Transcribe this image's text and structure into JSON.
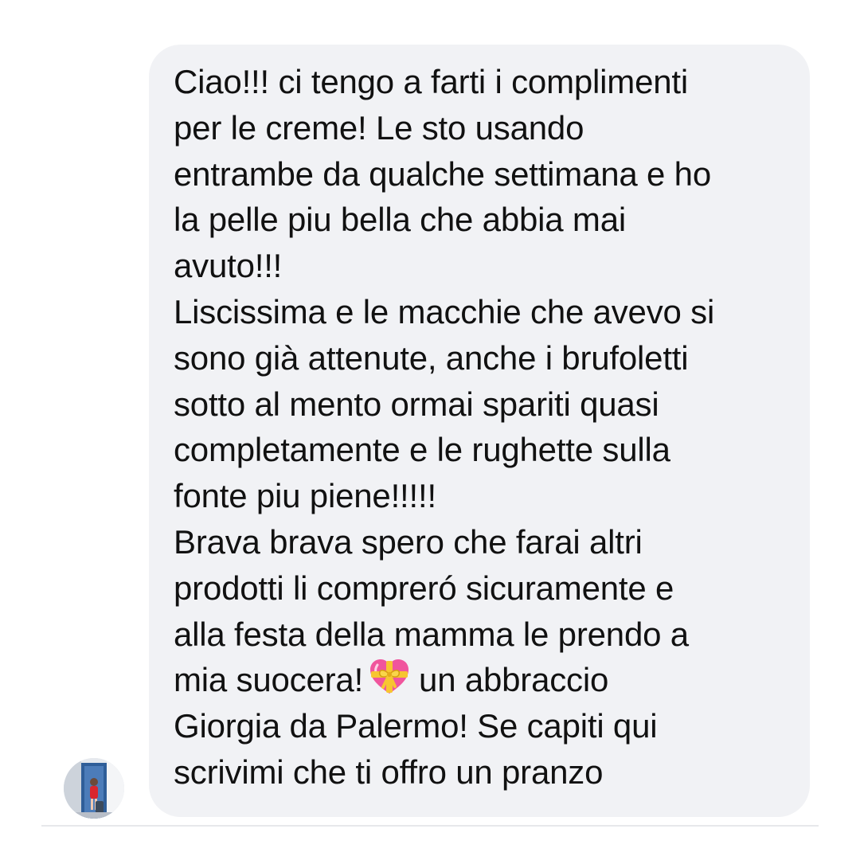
{
  "message": {
    "lines": [
      "Ciao!!! ci tengo a farti i complimenti",
      "per le creme! Le sto usando",
      "entrambe da qualche settimana e ho",
      "la pelle piu bella che abbia mai",
      "avuto!!!",
      "Liscissima e le macchie che avevo si",
      "sono già attenute, anche i brufoletti",
      "sotto al mento ormai spariti quasi",
      "completamente e le rughette sulla",
      "fonte piu piene!!!!!",
      "Brava brava spero che farai altri",
      "prodotti li compreró sicuramente e",
      "alla festa della mamma le prendo a",
      "mia suocera!",
      "Giorgia da Palermo! Se capiti qui",
      "scrivimi che ti offro un pranzo"
    ],
    "line14_after_emoji": "un abbraccio",
    "emoji": "heart-with-ribbon-icon",
    "bubble_color": "#f1f2f5",
    "text_color": "#111111"
  },
  "sender": {
    "avatar": "avatar"
  }
}
